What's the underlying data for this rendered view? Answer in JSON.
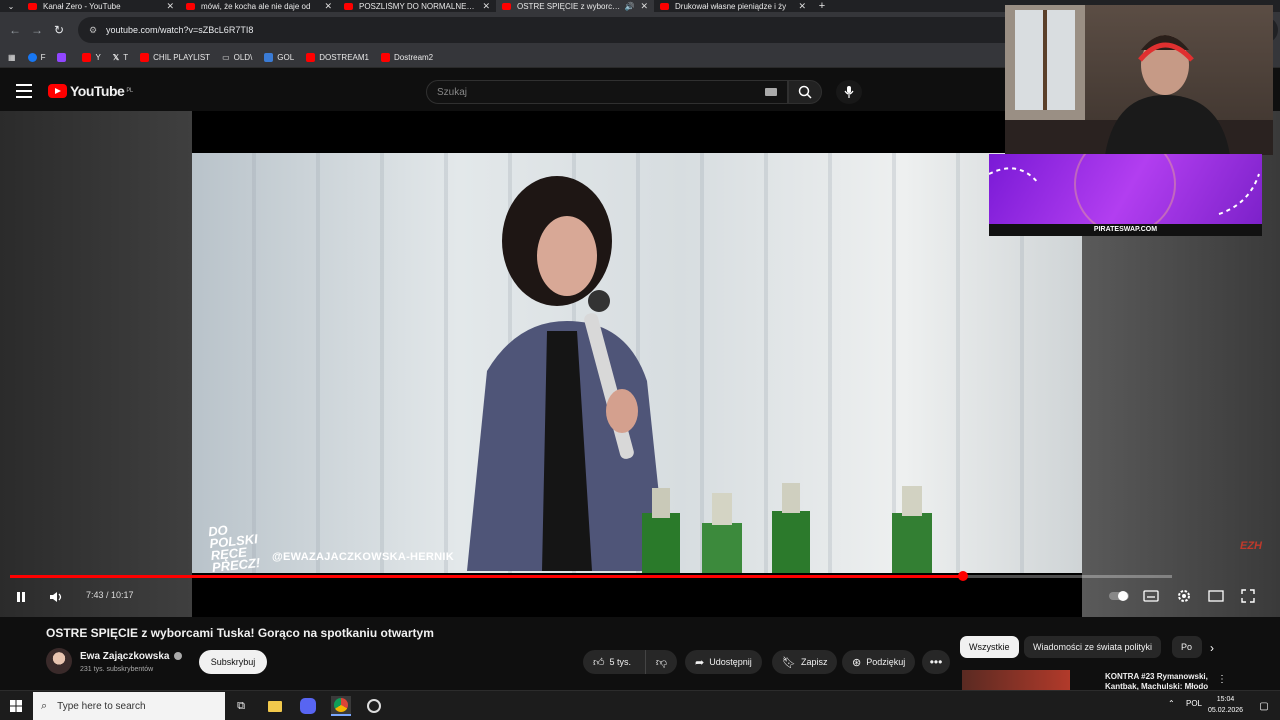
{
  "browser": {
    "tabs": [
      {
        "title": "Kanał Zero - YouTube",
        "active": false
      },
      {
        "title": "mówi, że kocha ale nie daje od",
        "active": false
      },
      {
        "title": "POSZLIŚMY DO NORMALNEJ P",
        "active": false
      },
      {
        "title": "OSTRE SPIĘCIE z wyborcam",
        "active": true,
        "audio": true
      },
      {
        "title": "Drukował własne pieniądze i ży",
        "active": false
      }
    ],
    "url": "youtube.com/watch?v=sZBcL6R7TI8",
    "bookmarks": [
      "F",
      "",
      "Y",
      "T",
      "CHIL PLAYLIST",
      "OLD\\",
      "GOL",
      "DOSTREAM1",
      "Dostream2"
    ]
  },
  "youtube": {
    "logo_text": "YouTube",
    "region": "PL",
    "search_placeholder": "Szukaj"
  },
  "player": {
    "overlay_logo": "DO POLSKI RĘCE PRECZ!",
    "overlay_handle": "@EWAZAJACZKOWSKA-HERNIK",
    "time": "7:43 / 10:17",
    "progress_fraction": 0.82,
    "watermark": "EZH",
    "sponsor": "PIRATESWAP.COM"
  },
  "video": {
    "title": "OSTRE SPIĘCIE z wyborcami Tuska! Gorąco na spotkaniu otwartym",
    "channel": "Ewa Zajączkowska",
    "subscribers": "231 tys. subskrybentów",
    "subscribe_label": "Subskrybuj",
    "likes": "5 tys.",
    "share_label": "Udostępnij",
    "save_label": "Zapisz",
    "thanks_label": "Podziękuj"
  },
  "chips": [
    "Wszystkie",
    "Wiadomości ze świata polityki",
    "Po"
  ],
  "recommendation": {
    "title": "KONTRA #23 Rymanowski, Kantbak, Machulski: Młodo wil"
  },
  "taskbar": {
    "search_placeholder": "Type here to search",
    "lang": "POL",
    "time": "15:04",
    "date": "05.02.2026"
  },
  "colors": {
    "accent": "#ff0000",
    "background": "#0f0f0f",
    "sponsor_purple": "#9b30e6"
  }
}
